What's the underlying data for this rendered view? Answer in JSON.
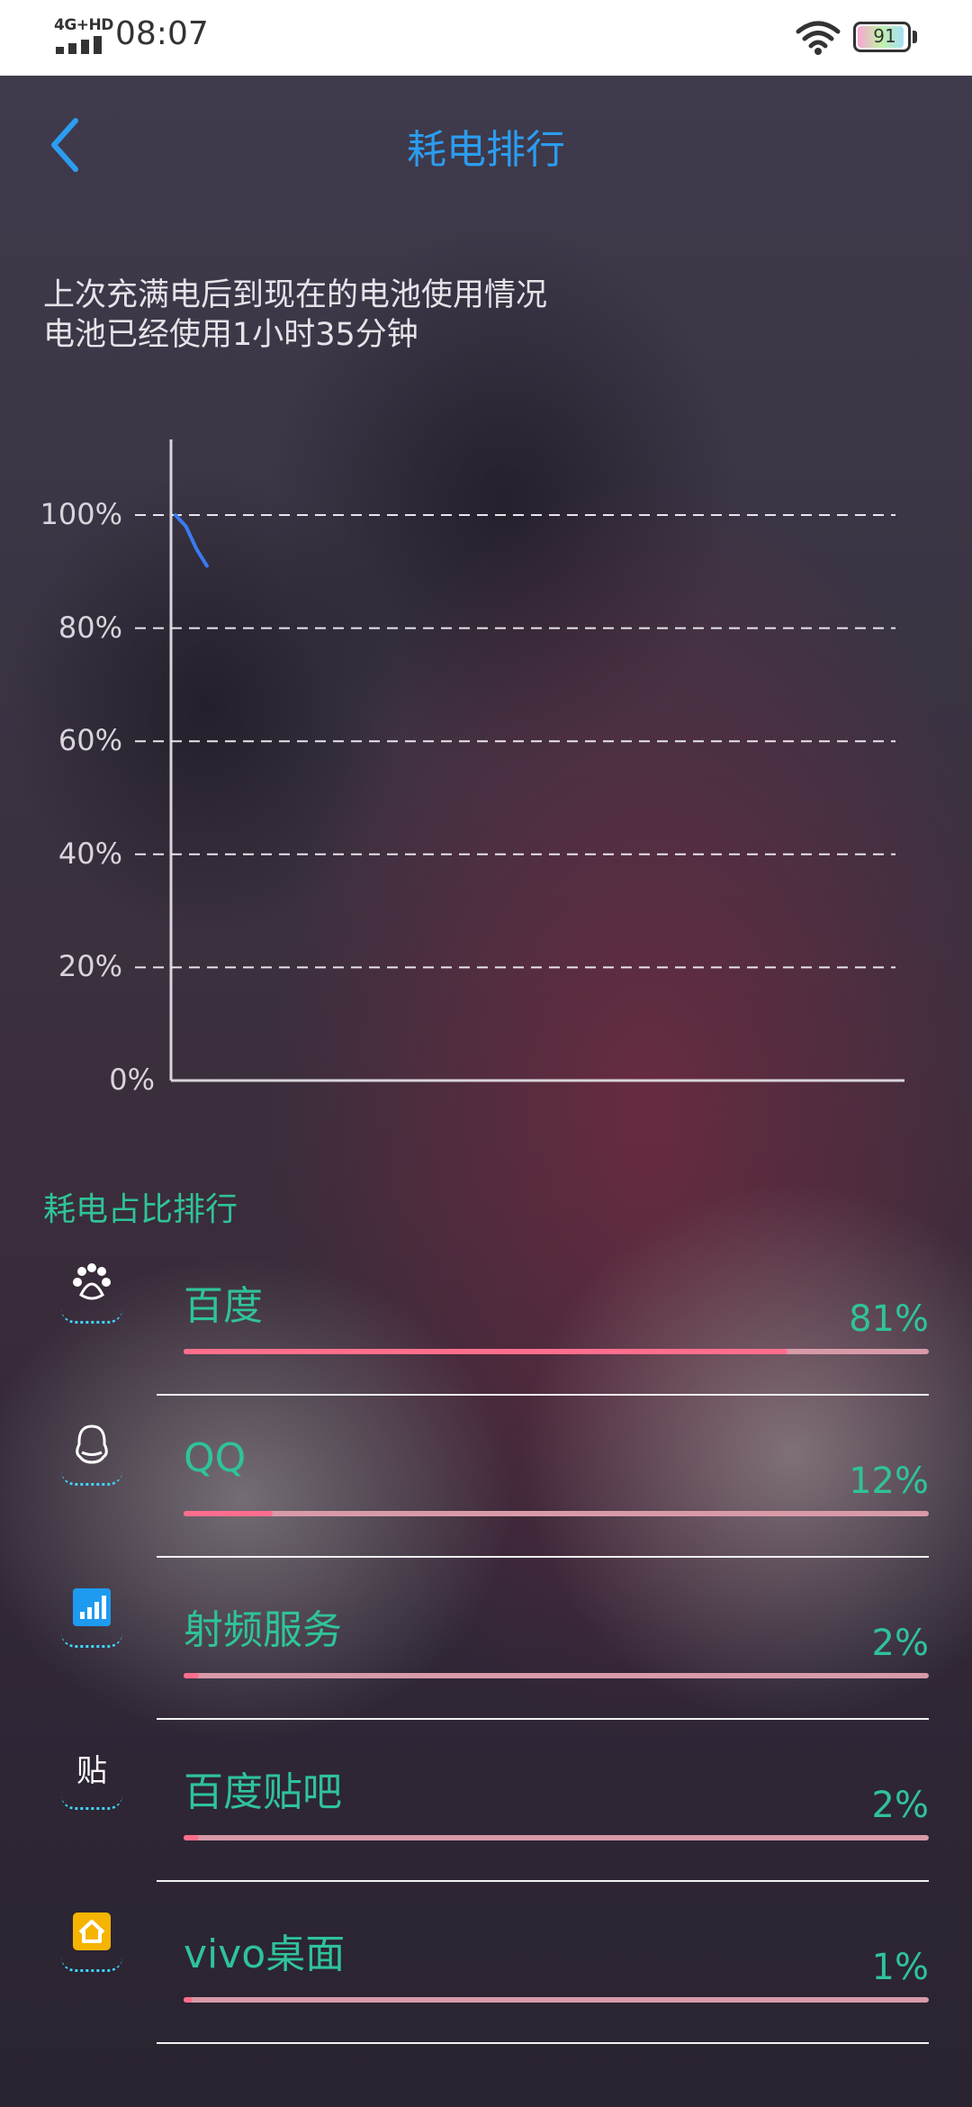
{
  "status_bar": {
    "network": "4G+HD",
    "time": "08:07",
    "battery": "91",
    "battery_level": 0.91
  },
  "header": {
    "back_icon": "chevron-left-icon",
    "title": "耗电排行"
  },
  "summary": {
    "line1": "上次充满电后到现在的电池使用情况",
    "line2": "电池已经使用1小时35分钟"
  },
  "chart_data": {
    "type": "line",
    "title": "",
    "xlabel": "",
    "ylabel": "",
    "y_tick_labels": [
      "100%",
      "80%",
      "60%",
      "40%",
      "20%",
      "0%"
    ],
    "ylim": [
      0,
      100
    ],
    "grid": true,
    "grid_style": "dashed",
    "series": [
      {
        "color": "#3a7bf0",
        "x": [
          0,
          1,
          2,
          3
        ],
        "y": [
          100,
          98,
          94,
          91
        ]
      }
    ],
    "x_max": 70
  },
  "ranking": {
    "title": "耗电占比排行",
    "apps": [
      {
        "name": "百度",
        "percent": "81%",
        "value": 0.81,
        "icon": "baidu-paw-icon",
        "icon_text": "du",
        "icon_color": "#ffffff"
      },
      {
        "name": "QQ",
        "percent": "12%",
        "value": 0.12,
        "icon": "qq-penguin-icon",
        "icon_text": "",
        "icon_color": "#ffffff"
      },
      {
        "name": "射频服务",
        "percent": "2%",
        "value": 0.02,
        "icon": "signal-bars-icon",
        "icon_text": "",
        "icon_color": "#1e9bf0"
      },
      {
        "name": "百度贴吧",
        "percent": "2%",
        "value": 0.02,
        "icon": "tieba-icon",
        "icon_text": "贴",
        "icon_color": "#ffffff"
      },
      {
        "name": "vivo桌面",
        "percent": "1%",
        "value": 0.01,
        "icon": "home-icon",
        "icon_text": "",
        "icon_color": "#f5b400"
      }
    ]
  }
}
